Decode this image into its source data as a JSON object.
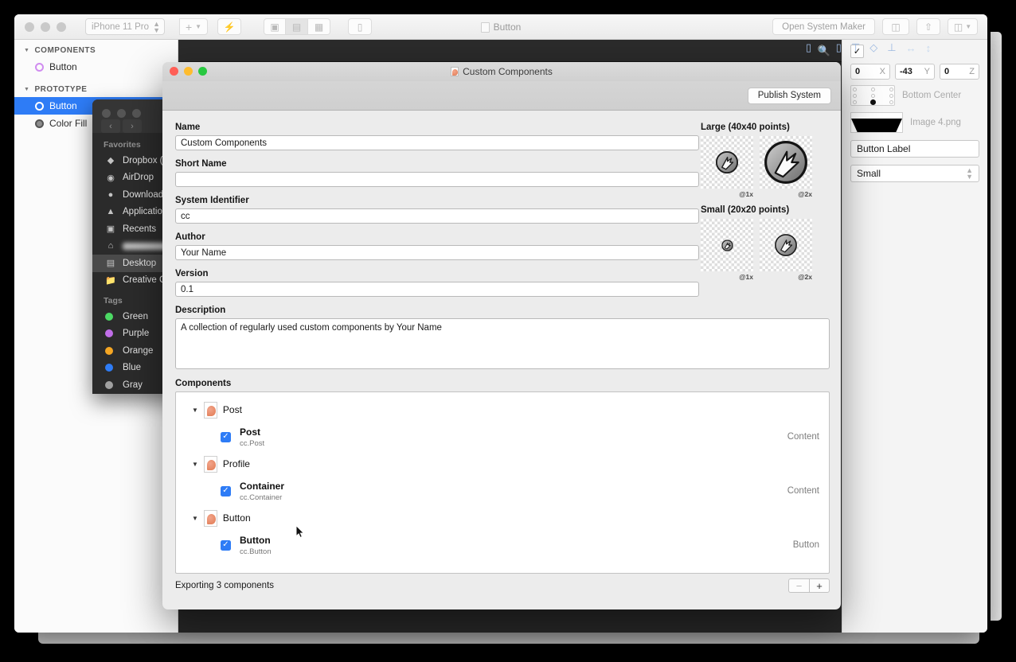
{
  "app": {
    "device_select": "iPhone 11 Pro",
    "add_button": "+",
    "title": "Button",
    "open_system_maker": "Open System Maker",
    "icons": {
      "add": "plus-icon",
      "chevron": "chevron-down-icon",
      "lightning": "lightning-bolt-icon",
      "layout_left": "layout-left-icon",
      "layout_center": "layout-center-icon",
      "layout_split": "layout-split-icon",
      "device": "device-preview-icon",
      "components_badge": "component-badge-icon",
      "preview": "preview-icon",
      "share": "share-icon",
      "panels": "panels-icon",
      "search": "search-icon"
    }
  },
  "sidebar": {
    "groups": [
      {
        "label": "COMPONENTS",
        "items": [
          {
            "label": "Button",
            "selected": false,
            "icon": "component-ring-icon"
          }
        ]
      },
      {
        "label": "PROTOTYPE",
        "items": [
          {
            "label": "Button",
            "selected": true,
            "icon": "layer-ring-icon"
          },
          {
            "label": "Color Fill",
            "selected": false,
            "icon": "fill-circle-icon"
          }
        ]
      }
    ]
  },
  "align_toolbar": {
    "items": [
      "align-left-icon",
      "align-center-horizontal-icon",
      "align-right-icon",
      "align-top-icon",
      "align-middle-vertical-icon",
      "align-bottom-icon",
      "distribute-horizontal-icon",
      "distribute-vertical-icon"
    ]
  },
  "inspector": {
    "checkbox_checked": "✓",
    "x_value": "0",
    "x_label": "X",
    "y_value": "-43",
    "y_label": "Y",
    "z_value": "0",
    "z_label": "Z",
    "anchor_label": "Bottom Center",
    "image_name": "Image 4.png",
    "button_label_value": "Button Label",
    "size_select_value": "Small"
  },
  "finder": {
    "sections": [
      {
        "label": "Favorites",
        "items": [
          {
            "label": "Dropbox (P",
            "icon": "dropbox-icon"
          },
          {
            "label": "AirDrop",
            "icon": "airdrop-icon"
          },
          {
            "label": "Downloads",
            "icon": "downloads-icon"
          },
          {
            "label": "Applications",
            "icon": "applications-icon"
          },
          {
            "label": "Recents",
            "icon": "recents-icon"
          },
          {
            "label": "",
            "icon": "home-icon",
            "blurred": true
          },
          {
            "label": "Desktop",
            "icon": "desktop-icon",
            "selected": true
          },
          {
            "label": "Creative Cl",
            "icon": "folder-icon"
          }
        ]
      },
      {
        "label": "Tags",
        "items": [
          {
            "label": "Green",
            "color": "#4cd964",
            "icon": "tag-dot-icon"
          },
          {
            "label": "Purple",
            "color": "#c06ee8",
            "icon": "tag-dot-icon"
          },
          {
            "label": "Orange",
            "color": "#f5a623",
            "icon": "tag-dot-icon"
          },
          {
            "label": "Blue",
            "color": "#2e7cf6",
            "icon": "tag-dot-icon"
          },
          {
            "label": "Gray",
            "color": "#a0a0a0",
            "icon": "tag-dot-icon"
          }
        ]
      }
    ],
    "nav_back": "‹",
    "nav_forward": "›"
  },
  "dialog": {
    "title": "Custom Components",
    "publish_button": "Publish System",
    "fields": [
      {
        "label": "Name",
        "value": "Custom Components"
      },
      {
        "label": "Short Name",
        "value": ""
      },
      {
        "label": "System Identifier",
        "value": "cc"
      },
      {
        "label": "Author",
        "value": "Your Name"
      },
      {
        "label": "Version",
        "value": "0.1"
      }
    ],
    "description_label": "Description",
    "description_value": "A collection of regularly used custom components by Your Name",
    "components_label": "Components",
    "icon_sections": [
      {
        "heading": "Large (40x40 points)",
        "cells": [
          {
            "caption": "@1x",
            "scale": 1
          },
          {
            "caption": "@2x",
            "scale": 2
          }
        ]
      },
      {
        "heading": "Small (20x20 points)",
        "cells": [
          {
            "caption": "@1x",
            "scale": 0.5
          },
          {
            "caption": "@2x",
            "scale": 1
          }
        ]
      }
    ],
    "component_groups": [
      {
        "name": "Post",
        "children": [
          {
            "name": "Post",
            "identifier": "cc.Post",
            "kind": "Content",
            "checked": true
          }
        ]
      },
      {
        "name": "Profile",
        "children": [
          {
            "name": "Container",
            "identifier": "cc.Container",
            "kind": "Content",
            "checked": true
          }
        ]
      },
      {
        "name": "Button",
        "children": [
          {
            "name": "Button",
            "identifier": "cc.Button",
            "kind": "Button",
            "checked": true
          }
        ]
      }
    ],
    "footer_status": "Exporting 3 components",
    "remove_button": "−",
    "add_button": "+"
  },
  "colors": {
    "accent": "#2e7cf6",
    "traffic_red": "#ff5f57",
    "traffic_yellow": "#febc2e",
    "traffic_green": "#28c840",
    "canvas_bg": "#272727",
    "dialog_bg": "#ececec"
  }
}
